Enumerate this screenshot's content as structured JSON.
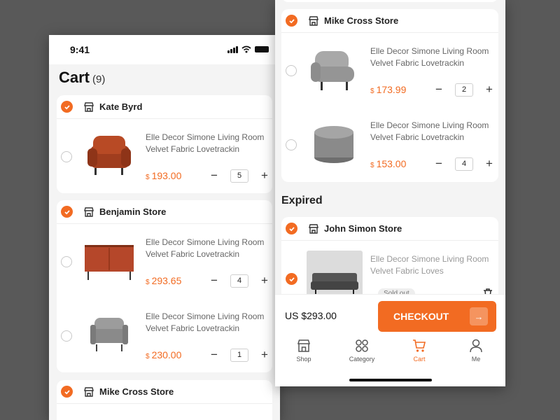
{
  "status": {
    "time": "9:41"
  },
  "cart": {
    "title": "Cart",
    "count": "(9)"
  },
  "left_stores": [
    {
      "name": "Kate Byrd",
      "items": [
        {
          "title": "Elle Decor Simone Living Room Velvet Fabric Lovetrackin",
          "currency": "$",
          "price": "193.00",
          "qty": "5",
          "image": "armchair-rust"
        }
      ]
    },
    {
      "name": "Benjamin Store",
      "items": [
        {
          "title": "Elle Decor Simone Living Room Velvet Fabric Lovetrackin",
          "currency": "$",
          "price": "293.65",
          "qty": "4",
          "image": "sideboard-rust"
        },
        {
          "title": "Elle Decor Simone Living Room Velvet Fabric Lovetrackin",
          "currency": "$",
          "price": "230.00",
          "qty": "1",
          "image": "armchair-grey"
        }
      ]
    },
    {
      "name": "Mike Cross Store"
    }
  ],
  "right_stores": [
    {
      "name": "Mike Cross Store",
      "items": [
        {
          "title": "Elle Decor Simone Living Room Velvet Fabric Lovetrackin",
          "currency": "$",
          "price": "173.99",
          "qty": "2",
          "image": "lounge-chair-grey"
        },
        {
          "title": "Elle Decor Simone Living Room Velvet Fabric Lovetrackin",
          "currency": "$",
          "price": "153.00",
          "qty": "4",
          "image": "pouf-grey"
        }
      ]
    }
  ],
  "expired": {
    "title": "Expired",
    "store": {
      "name": "John Simon Store",
      "items": [
        {
          "title": "Elle Decor Simone Living Room Velvet Fabric Loves",
          "status": "Sold out",
          "image": "sofa-grey"
        }
      ]
    }
  },
  "checkout": {
    "total": "US $293.00",
    "button": "CHECKOUT",
    "arrow": "→"
  },
  "nav": [
    {
      "label": "Shop",
      "icon": "shop-icon",
      "active": false
    },
    {
      "label": "Category",
      "icon": "category-icon",
      "active": false
    },
    {
      "label": "Cart",
      "icon": "cart-icon",
      "active": true
    },
    {
      "label": "Me",
      "icon": "user-icon",
      "active": false
    }
  ],
  "colors": {
    "accent": "#f26b22",
    "background": "#595959"
  }
}
